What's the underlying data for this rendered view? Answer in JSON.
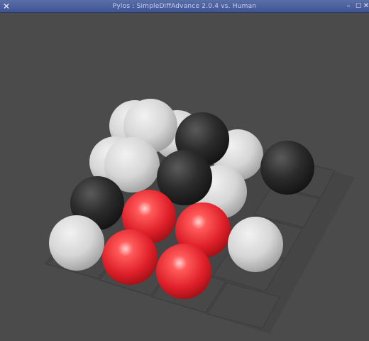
{
  "window": {
    "title": "Pylos : SimpleDiffAdvance 2.0.4 vs. Human",
    "menu_icon": "x-close-icon",
    "minimize_icon": "minimize-icon",
    "maximize_icon": "maximize-icon",
    "close_icon": "close-icon"
  },
  "colors": {
    "background": "#4a4b4a",
    "board": "#3a3b3a",
    "white_ball": "#d8d8d8",
    "black_ball": "#2a2a2a",
    "red_ball": "#e0202a",
    "titlebar": "#4b60a0"
  },
  "board": {
    "size": "4x4",
    "pieces": [
      {
        "color": "white",
        "level": 0
      },
      {
        "color": "white",
        "level": 0
      },
      {
        "color": "white",
        "level": 0
      },
      {
        "color": "black",
        "level": 0
      },
      {
        "color": "white",
        "level": 0
      },
      {
        "color": "white",
        "level": 0
      },
      {
        "color": "black",
        "level": 0
      },
      {
        "color": "black",
        "level": 0
      },
      {
        "color": "white",
        "level": 0
      },
      {
        "color": "white",
        "level": 0
      },
      {
        "color": "red",
        "level": 0
      },
      {
        "color": "red",
        "level": 0
      },
      {
        "color": "red",
        "level": 0
      },
      {
        "color": "red",
        "level": 0
      },
      {
        "color": "white",
        "level": 0
      },
      {
        "color": "black",
        "level": 1
      }
    ]
  }
}
